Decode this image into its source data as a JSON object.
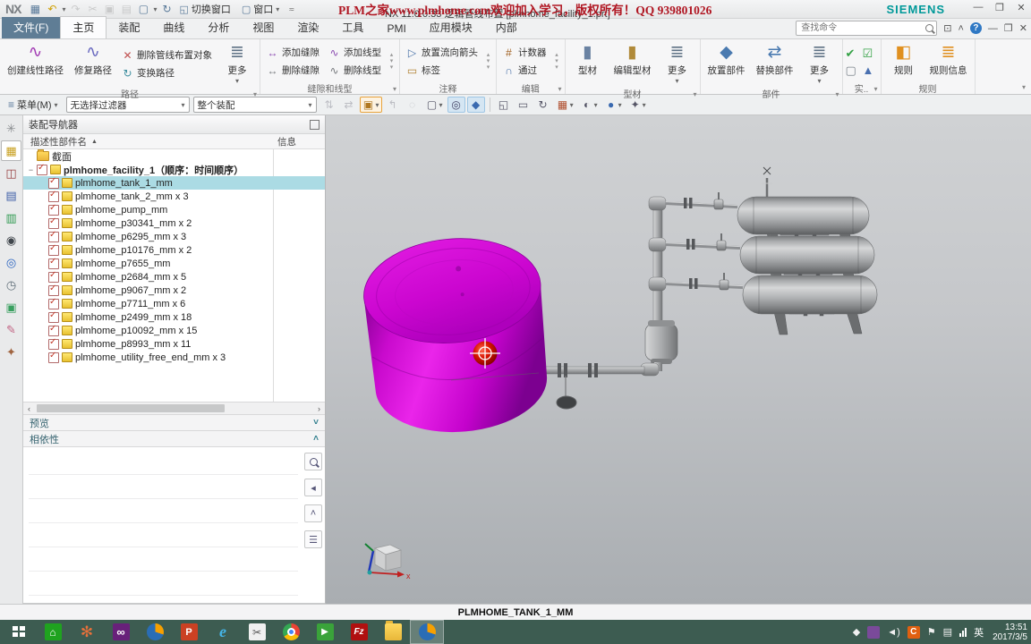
{
  "title_bar": {
    "app_logo": "NX",
    "quick_access_icons": [
      {
        "name": "save-icon"
      },
      {
        "name": "undo-icon",
        "dd": true
      },
      {
        "name": "redo-icon",
        "disabled": true
      },
      {
        "name": "cut-icon",
        "disabled": true
      },
      {
        "name": "copy-icon",
        "disabled": true
      },
      {
        "name": "paste-icon",
        "disabled": true
      },
      {
        "name": "new-window-icon",
        "dd": true
      },
      {
        "name": "command-repeat-icon"
      }
    ],
    "switch_window_label": "切换窗口",
    "window_menu_label": "窗口",
    "overlay_text": "PLM之家www.plmhome.com欢迎加入学习，版权所有！QQ 939801026",
    "window_title": "NX 11.0.0.33 逻辑管线布置  [plmhome_facility_1.prt]",
    "brand": "SIEMENS",
    "window_controls": [
      {
        "name": "minimize-icon",
        "glyph": "—"
      },
      {
        "name": "restore-icon",
        "glyph": "❐"
      },
      {
        "name": "close-icon",
        "glyph": "✕"
      }
    ]
  },
  "tab_bar": {
    "file_tab": "文件(F)",
    "tabs": [
      "主页",
      "装配",
      "曲线",
      "分析",
      "视图",
      "渲染",
      "工具",
      "PMI",
      "应用模块",
      "内部"
    ],
    "active_tab": "主页",
    "search_placeholder": "查找命令",
    "right_icons": [
      "window-dialog-icon",
      "minimize-ribbon-icon",
      "help-icon",
      "minimize-icon",
      "restore-icon",
      "close-icon"
    ]
  },
  "ribbon": {
    "groups": [
      {
        "label": "路径",
        "launcher": true,
        "blocks": [
          {
            "type": "big",
            "items": [
              {
                "icon": "create-linear-path-icon",
                "label": "创建线性路径"
              },
              {
                "icon": "heal-path-icon",
                "label": "修复路径"
              }
            ]
          },
          {
            "type": "col",
            "items": [
              {
                "icon": "delete-routing-icon",
                "label": "删除管线布置对象"
              },
              {
                "icon": "transform-path-icon",
                "label": "变换路径"
              }
            ]
          },
          {
            "type": "big",
            "items": [
              {
                "icon": "more-icon",
                "label": "更多",
                "dd": true
              }
            ]
          }
        ]
      },
      {
        "label": "缝隙和线型",
        "launcher": true,
        "blocks": [
          {
            "type": "col",
            "items": [
              {
                "icon": "add-gap-icon",
                "label": "添加缝隙"
              },
              {
                "icon": "remove-gap-icon",
                "label": "删除缝隙"
              }
            ]
          },
          {
            "type": "col",
            "items": [
              {
                "icon": "add-linetype-icon",
                "label": "添加线型"
              },
              {
                "icon": "remove-linetype-icon",
                "label": "删除线型"
              }
            ]
          },
          {
            "type": "arrows"
          }
        ]
      },
      {
        "label": "注释",
        "launcher": false,
        "blocks": [
          {
            "type": "col",
            "items": [
              {
                "icon": "flow-arrow-icon",
                "label": "放置流向箭头"
              },
              {
                "icon": "label-icon",
                "label": "标签"
              }
            ]
          },
          {
            "type": "arrows"
          }
        ]
      },
      {
        "label": "编辑",
        "launcher": true,
        "blocks": [
          {
            "type": "col",
            "items": [
              {
                "icon": "counter-icon",
                "label": "计数器"
              },
              {
                "icon": "through-icon",
                "label": "通过"
              }
            ]
          },
          {
            "type": "arrows"
          }
        ]
      },
      {
        "label": "型材",
        "launcher": true,
        "blocks": [
          {
            "type": "big",
            "items": [
              {
                "icon": "stock-icon",
                "label": "型材"
              },
              {
                "icon": "edit-stock-icon",
                "label": "编辑型材"
              },
              {
                "icon": "more-icon",
                "label": "更多",
                "dd": true
              }
            ]
          }
        ]
      },
      {
        "label": "部件",
        "launcher": true,
        "blocks": [
          {
            "type": "big",
            "items": [
              {
                "icon": "place-part-icon",
                "label": "放置部件"
              },
              {
                "icon": "replace-part-icon",
                "label": "替换部件"
              },
              {
                "icon": "more-icon",
                "label": "更多",
                "dd": true
              }
            ]
          }
        ]
      },
      {
        "label": "实..",
        "launcher": true,
        "blocks": [
          {
            "type": "icongrid",
            "items": [
              {
                "icon": "check-mate-icon"
              },
              {
                "icon": "check-list-icon"
              },
              {
                "icon": "window-util-icon"
              },
              {
                "icon": "fixture-icon"
              }
            ]
          }
        ]
      },
      {
        "label": "规则",
        "launcher": false,
        "blocks": [
          {
            "type": "big",
            "items": [
              {
                "icon": "rules-icon",
                "label": "规则"
              },
              {
                "icon": "rule-info-icon",
                "label": "规则信息"
              }
            ]
          }
        ]
      }
    ]
  },
  "border_bar": {
    "menu_label": "菜单(M)",
    "selection_filter": "无选择过滤器",
    "selection_scope": "整个装配",
    "icons": [
      {
        "name": "move-component-icon",
        "disabled": true
      },
      {
        "name": "assembly-constraint-icon",
        "disabled": true
      },
      {
        "name": "snap-point-icon",
        "dd": true,
        "highlight": true
      },
      {
        "name": "point-on-curve-icon",
        "disabled": true
      },
      {
        "name": "lasso-icon",
        "disabled": true
      },
      {
        "name": "rect-select-icon",
        "dd": true
      },
      {
        "name": "highlight-faces-icon",
        "pressed": true
      },
      {
        "name": "shaded-solid-icon",
        "pressed": true
      },
      {
        "name": "separator"
      },
      {
        "name": "fit-view-icon"
      },
      {
        "name": "zoom-window-icon"
      },
      {
        "name": "rotate-view-icon"
      },
      {
        "name": "wcs-icon",
        "dd": true
      },
      {
        "name": "render-style-icon",
        "dd": true
      },
      {
        "name": "background-icon",
        "dd": true
      },
      {
        "name": "view-orient-icon",
        "dd": true
      }
    ]
  },
  "resource_bar": {
    "icons": [
      {
        "name": "gear-icon"
      },
      {
        "name": "assembly-navigator-icon",
        "active": true
      },
      {
        "name": "constraint-navigator-icon"
      },
      {
        "name": "part-navigator-icon"
      },
      {
        "name": "reuse-library-icon"
      },
      {
        "name": "hd3d-tools-icon"
      },
      {
        "name": "web-browser-icon"
      },
      {
        "name": "history-icon"
      },
      {
        "name": "process-studio-icon"
      },
      {
        "name": "materials-icon"
      },
      {
        "name": "roles-icon"
      }
    ]
  },
  "navigator": {
    "title": "装配导航器",
    "columns": {
      "name": "描述性部件名",
      "info": "信息"
    },
    "section_row": "截面",
    "root_row": "plmhome_facility_1（顺序：时间顺序）",
    "rows": [
      {
        "label": "plmhome_tank_1_mm",
        "selected": true
      },
      {
        "label": "plmhome_tank_2_mm x 3"
      },
      {
        "label": "plmhome_pump_mm"
      },
      {
        "label": "plmhome_p30341_mm x 2"
      },
      {
        "label": "plmhome_p6295_mm x 3"
      },
      {
        "label": "plmhome_p10176_mm x 2"
      },
      {
        "label": "plmhome_p7655_mm"
      },
      {
        "label": "plmhome_p2684_mm x 5"
      },
      {
        "label": "plmhome_p9067_mm x 2"
      },
      {
        "label": "plmhome_p7711_mm x 6"
      },
      {
        "label": "plmhome_p2499_mm x 18"
      },
      {
        "label": "plmhome_p10092_mm x 15"
      },
      {
        "label": "plmhome_p8993_mm x 11"
      },
      {
        "label": "plmhome_utility_free_end_mm x 3"
      }
    ],
    "preview_label": "预览",
    "dependencies_label": "相依性",
    "dep_icons": [
      "search-icon",
      "back-icon",
      "expand-icon",
      "list-icon"
    ]
  },
  "viewport": {
    "status_label": "PLMHOME_TANK_1_MM",
    "triad": {
      "x_label": "x"
    },
    "selected_object_color": "#d405d4",
    "marker_color": "#c81200"
  },
  "taskbar": {
    "apps": [
      {
        "name": "windows-store"
      },
      {
        "name": "media-app"
      },
      {
        "name": "visual-studio"
      },
      {
        "name": "nx-launcher"
      },
      {
        "name": "powerpoint"
      },
      {
        "name": "internet-explorer"
      },
      {
        "name": "snipping-tool"
      },
      {
        "name": "chrome"
      },
      {
        "name": "video-converter"
      },
      {
        "name": "filezilla"
      },
      {
        "name": "file-explorer"
      },
      {
        "name": "nx-running",
        "active": true
      }
    ],
    "tray": {
      "icons": [
        "show-hidden-icon",
        "ime-icon",
        "volume-icon",
        "c-app-icon",
        "flag-icon",
        "system-icon",
        "signal-icon"
      ],
      "language": "英",
      "time": "13:51",
      "date": "2017/3/5"
    }
  }
}
